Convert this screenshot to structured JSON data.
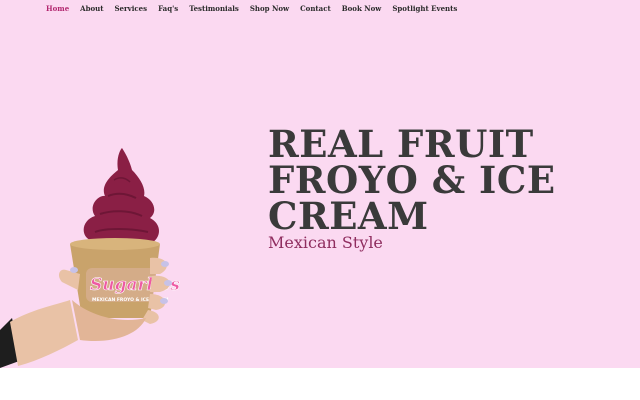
{
  "nav": {
    "items": [
      {
        "label": "Home",
        "active": true
      },
      {
        "label": "About"
      },
      {
        "label": "Services"
      },
      {
        "label": "Faq's"
      },
      {
        "label": "Testimonials"
      },
      {
        "label": "Shop Now"
      },
      {
        "label": "Contact"
      },
      {
        "label": "Book Now"
      },
      {
        "label": "Spotlight Events"
      }
    ]
  },
  "hero": {
    "headline_lines": [
      "REAL FRUIT",
      "FROYO & ICE",
      "CREAM"
    ],
    "subhead": "Mexican Style",
    "cup_logo": "Sugarlies",
    "cup_tagline": "MEXICAN FROYO & ICE CREAM",
    "colors": {
      "background": "#fbd9f1",
      "headline": "#3a3a3a",
      "subhead": "#8f2d5f",
      "nav_active": "#b2266f"
    }
  }
}
